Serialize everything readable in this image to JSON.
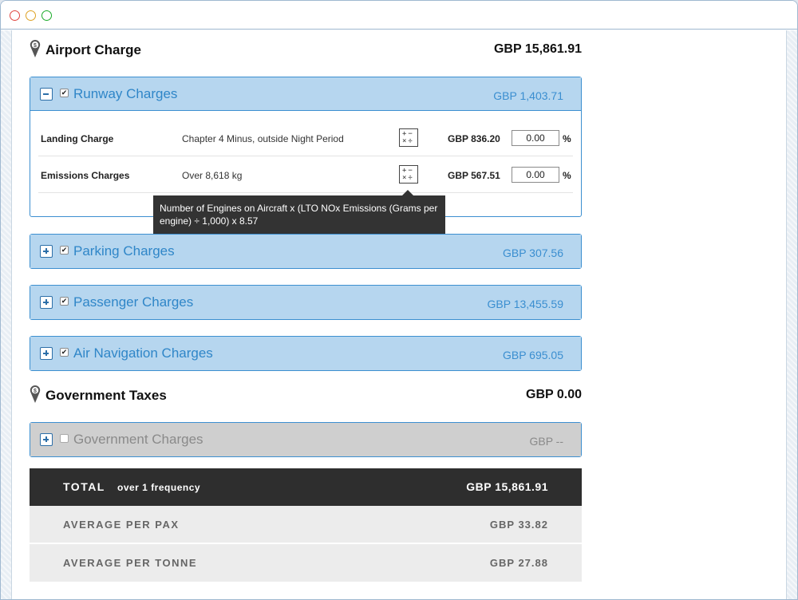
{
  "airport": {
    "title": "Airport Charge",
    "total": "GBP 15,861.91"
  },
  "runway": {
    "title": "Runway Charges",
    "amount": "GBP 1,403.71",
    "checked": "✔",
    "rows": [
      {
        "name": "Landing Charge",
        "description": "Chapter 4 Minus, outside Night Period",
        "calc": "+−×÷",
        "amount": "GBP 836.20",
        "percent_value": "0.00",
        "percent_sign": "%"
      },
      {
        "name": "Emissions Charges",
        "description": "Over 8,618 kg",
        "calc": "+−×÷",
        "amount": "GBP 567.51",
        "percent_value": "0.00",
        "percent_sign": "%"
      }
    ],
    "tooltip": "Number of Engines on Aircraft x (LTO NOx Emissions (Grams per engine) ÷ 1,000) x 8.57"
  },
  "parking": {
    "title": "Parking Charges",
    "amount": "GBP 307.56",
    "checked": "✔"
  },
  "passenger": {
    "title": "Passenger Charges",
    "amount": "GBP 13,455.59",
    "checked": "✔"
  },
  "air_navigation": {
    "title": "Air Navigation Charges",
    "amount": "GBP 695.05",
    "checked": "✔"
  },
  "government": {
    "title": "Government Taxes",
    "total": "GBP 0.00",
    "panel_title": "Government Charges",
    "panel_amount": "GBP --"
  },
  "summary": {
    "total_label": "TOTAL",
    "total_sub": "over 1 frequency",
    "total_value": "GBP 15,861.91",
    "avg_pax_label": "AVERAGE PER PAX",
    "avg_pax_value": "GBP 33.82",
    "avg_tonne_label": "AVERAGE PER TONNE",
    "avg_tonne_value": "GBP 27.88"
  },
  "colors": {
    "panel_header": "#b6d6ef",
    "panel_border": "#3c8fd0",
    "panel_title": "#2f86c8",
    "total_bar": "#2e2e2e",
    "tooltip": "#333333"
  },
  "icons": {
    "section": "dollar-pin-icon",
    "collapse": "minus-box-icon",
    "expand": "plus-box-icon",
    "calculator": "calculator-icon"
  }
}
